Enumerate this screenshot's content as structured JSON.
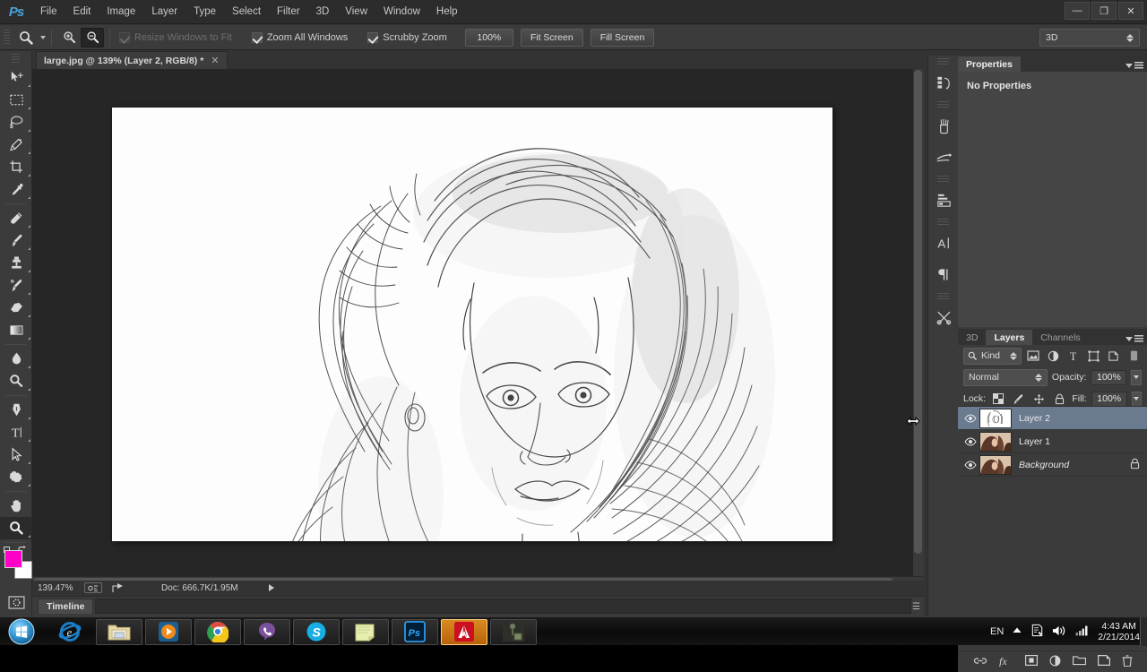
{
  "app": {
    "name": "Adobe Photoshop CC",
    "logo_text": "Ps",
    "menus": [
      "File",
      "Edit",
      "Image",
      "Layer",
      "Type",
      "Select",
      "Filter",
      "3D",
      "View",
      "Window",
      "Help"
    ],
    "window_controls": {
      "minimize": "—",
      "restore": "❐",
      "close": "✕"
    }
  },
  "options_bar": {
    "tool_icon": "zoom-tool-icon",
    "zoom_in_label": "zoom-in-icon",
    "zoom_out_label": "zoom-out-icon",
    "checkboxes": [
      {
        "label": "Resize Windows to Fit",
        "checked": true,
        "enabled": false
      },
      {
        "label": "Zoom All Windows",
        "checked": true,
        "enabled": true
      },
      {
        "label": "Scrubby Zoom",
        "checked": true,
        "enabled": true
      }
    ],
    "buttons": [
      "100%",
      "Fit Screen",
      "Fill Screen"
    ],
    "workspace": "3D"
  },
  "document": {
    "tab_title": "large.jpg @ 139% (Layer 2, RGB/8) *",
    "close_glyph": "✕"
  },
  "toolbar": {
    "tools": [
      {
        "name": "move-tool",
        "group": 1
      },
      {
        "name": "rectangular-marquee-tool",
        "group": 1
      },
      {
        "name": "lasso-tool",
        "group": 1
      },
      {
        "name": "quick-selection-tool",
        "group": 1
      },
      {
        "name": "crop-tool",
        "group": 1
      },
      {
        "name": "eyedropper-tool",
        "group": 1
      },
      {
        "name": "spot-healing-brush-tool",
        "group": 2
      },
      {
        "name": "brush-tool",
        "group": 2
      },
      {
        "name": "clone-stamp-tool",
        "group": 2
      },
      {
        "name": "history-brush-tool",
        "group": 2
      },
      {
        "name": "eraser-tool",
        "group": 2
      },
      {
        "name": "gradient-tool",
        "group": 2
      },
      {
        "name": "blur-tool",
        "group": 3
      },
      {
        "name": "dodge-tool",
        "group": 3
      },
      {
        "name": "pen-tool",
        "group": 4
      },
      {
        "name": "horizontal-type-tool",
        "group": 4
      },
      {
        "name": "path-selection-tool",
        "group": 4
      },
      {
        "name": "custom-shape-tool",
        "group": 4
      },
      {
        "name": "hand-tool",
        "group": 5
      },
      {
        "name": "zoom-tool",
        "group": 5,
        "selected": true
      }
    ],
    "foreground_color": "#ff00c8",
    "background_color": "#ffffff",
    "type_tool_glyph": "T"
  },
  "properties_panel": {
    "tab": "Properties",
    "empty_message": "No Properties"
  },
  "layers_panel": {
    "tabs": [
      {
        "label": "3D",
        "active": false
      },
      {
        "label": "Layers",
        "active": true
      },
      {
        "label": "Channels",
        "active": false
      }
    ],
    "filter_label": "Kind",
    "filter_icons": [
      "pixel-filter-icon",
      "adjustment-filter-icon",
      "type-filter-icon",
      "shape-filter-icon",
      "smart-object-filter-icon"
    ],
    "blend_mode": "Normal",
    "opacity_label": "Opacity:",
    "opacity_value": "100%",
    "lock_label": "Lock:",
    "lock_icons": [
      "lock-transparent-pixels-icon",
      "lock-image-pixels-icon",
      "lock-position-icon",
      "lock-all-icon"
    ],
    "fill_label": "Fill:",
    "fill_value": "100%",
    "layers": [
      {
        "name": "Layer 2",
        "visible": true,
        "selected": true,
        "locked": false,
        "italic": false,
        "thumb": "sketch"
      },
      {
        "name": "Layer 1",
        "visible": true,
        "selected": false,
        "locked": false,
        "italic": false,
        "thumb": "photo"
      },
      {
        "name": "Background",
        "visible": true,
        "selected": false,
        "locked": true,
        "italic": true,
        "thumb": "photo"
      }
    ],
    "footer_buttons": [
      "link-layers-icon",
      "layer-style-fx-icon",
      "add-layer-mask-icon",
      "new-adjustment-layer-icon",
      "new-group-icon",
      "new-layer-icon",
      "delete-layer-icon"
    ]
  },
  "icon_dock": [
    "history-panel-icon",
    "brush-presets-panel-icon",
    "brush-panel-icon",
    "adjustments-panel-icon",
    "character-panel-icon",
    "paragraph-panel-icon",
    "tool-presets-panel-icon"
  ],
  "status_bar": {
    "zoom_level": "139.47%",
    "doc_info": "Doc: 666.7K/1.95M",
    "icons": [
      "document-info-icon",
      "share-icon"
    ]
  },
  "timeline": {
    "tab": "Timeline"
  },
  "taskbar": {
    "start_label": "start-orb",
    "items": [
      {
        "name": "internet-explorer-icon",
        "framed": false,
        "active": false
      },
      {
        "name": "file-explorer-icon",
        "framed": true,
        "active": false
      },
      {
        "name": "windows-media-player-icon",
        "framed": true,
        "active": false
      },
      {
        "name": "google-chrome-icon",
        "framed": true,
        "active": false
      },
      {
        "name": "viber-icon",
        "framed": true,
        "active": false
      },
      {
        "name": "skype-icon",
        "framed": true,
        "active": false
      },
      {
        "name": "sticky-notes-icon",
        "framed": true,
        "active": false
      },
      {
        "name": "photoshop-icon",
        "framed": true,
        "active": false,
        "label": "Ps"
      },
      {
        "name": "adobe-icon",
        "framed": true,
        "active": true,
        "label": "A"
      },
      {
        "name": "unknown-app-icon",
        "framed": true,
        "active": false
      }
    ],
    "tray": {
      "language": "EN",
      "icons": [
        "show-hidden-icons-icon",
        "action-center-icon",
        "volume-icon",
        "network-icon"
      ],
      "time": "4:43 AM",
      "date": "2/21/2014"
    }
  },
  "cursor": {
    "type": "horizontal-resize-cursor"
  }
}
